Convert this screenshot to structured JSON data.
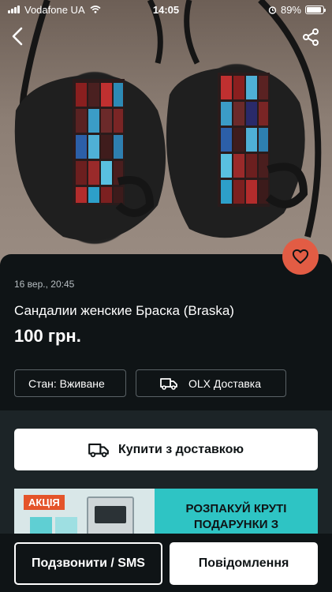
{
  "status_bar": {
    "carrier": "Vodafone UA",
    "time": "14:05",
    "battery": "89%",
    "battery_level": 0.89
  },
  "header": {
    "back_icon": "chevron-left-icon",
    "share_icon": "share-icon"
  },
  "listing": {
    "date": "16 вер., 20:45",
    "title": "Сандалии женские Браска (Braska)",
    "price": "100 грн.",
    "condition": "Стан: Вживане",
    "delivery": "OLX Доставка",
    "favorite_icon": "heart-icon",
    "favorite_color": "#e25c44"
  },
  "actions": {
    "buy_label": "Купити з доставкою",
    "call_label": "Подзвонити / SMS",
    "message_label": "Повідомлення"
  },
  "banner": {
    "badge": "АКЦІЯ",
    "line1": "РОЗПАКУЙ КРУТІ",
    "line2": "ПОДАРУНКИ З",
    "accent_color": "#2ec4c4"
  }
}
